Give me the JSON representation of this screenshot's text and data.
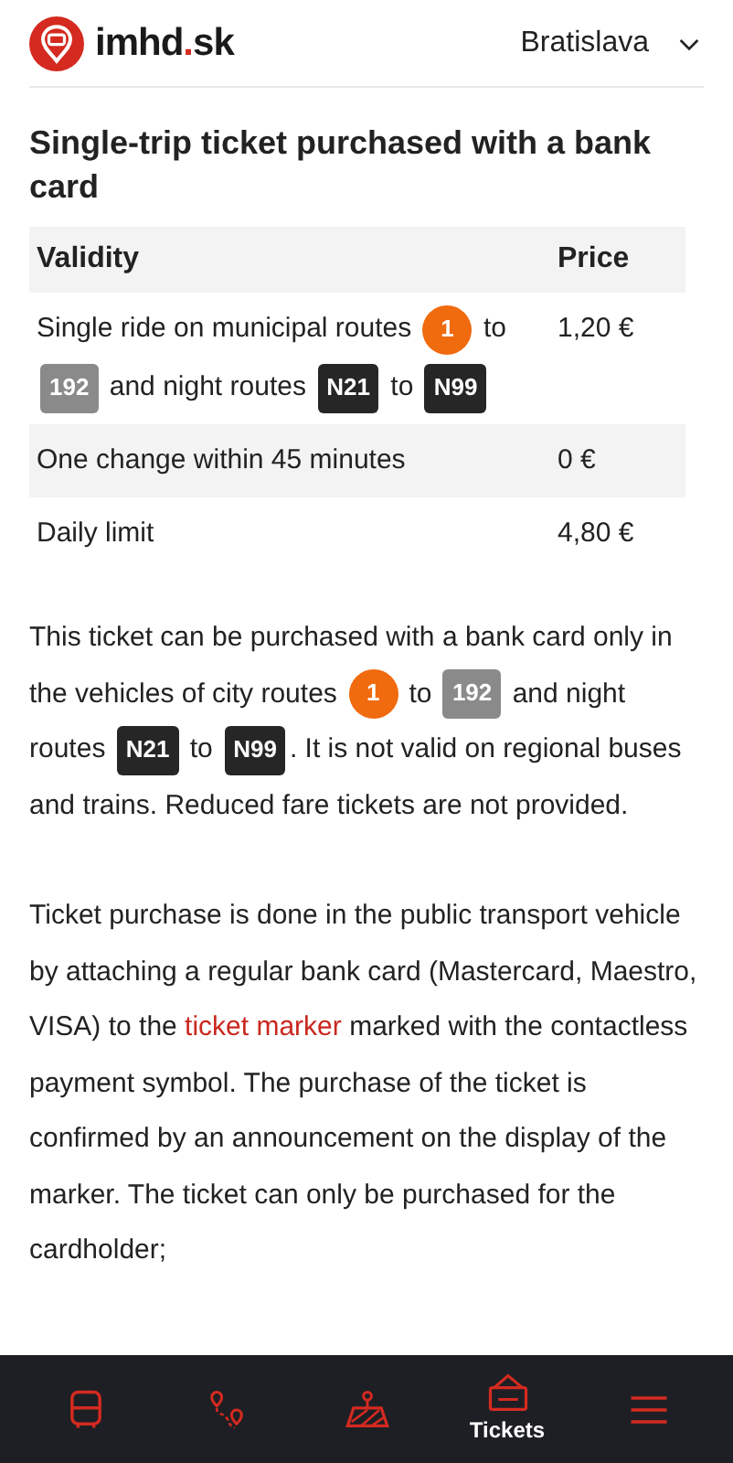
{
  "header": {
    "logo": {
      "name": "imhd",
      "dot": ".",
      "tld": "sk"
    },
    "city": "Bratislava"
  },
  "title": "Single-trip ticket purchased with a bank card",
  "table": {
    "columns": [
      "Validity",
      "Price"
    ],
    "rows": [
      {
        "validity": [
          {
            "kind": "text",
            "text": "Single ride on municipal routes "
          },
          {
            "kind": "tram",
            "text": "1"
          },
          {
            "kind": "text",
            "text": " to "
          },
          {
            "kind": "bus",
            "text": "192"
          },
          {
            "kind": "text",
            "text": " and night routes "
          },
          {
            "kind": "night",
            "text": "N21"
          },
          {
            "kind": "text",
            "text": " to "
          },
          {
            "kind": "night",
            "text": "N99"
          }
        ],
        "price": "1,20 €"
      },
      {
        "validity": [
          {
            "kind": "text",
            "text": "One change within 45 minutes"
          }
        ],
        "price": "0 €"
      },
      {
        "validity": [
          {
            "kind": "text",
            "text": "Daily limit"
          }
        ],
        "price": "4,80 €"
      }
    ]
  },
  "paragraphs": [
    [
      {
        "kind": "text",
        "text": "This ticket can be purchased with a bank card only in the vehicles of city routes "
      },
      {
        "kind": "tram",
        "text": "1"
      },
      {
        "kind": "text",
        "text": " to "
      },
      {
        "kind": "bus",
        "text": "192"
      },
      {
        "kind": "text",
        "text": " and night routes "
      },
      {
        "kind": "night",
        "text": "N21"
      },
      {
        "kind": "text",
        "text": " to "
      },
      {
        "kind": "night",
        "text": "N99"
      },
      {
        "kind": "text",
        "text": ". It is not valid on regional buses and trains. Reduced fare tickets are not provided."
      }
    ],
    [
      {
        "kind": "text",
        "text": "Ticket purchase is done in the public transport vehicle by attaching a regular bank card (Mastercard, Maestro, VISA) to the "
      },
      {
        "kind": "link",
        "text": "ticket marker"
      },
      {
        "kind": "text",
        "text": " marked with the contactless payment symbol. The purchase of the ticket is confirmed by an announcement on the display of the marker. The ticket can only be purchased for the cardholder;"
      }
    ]
  ],
  "nav": [
    {
      "selected": false
    },
    {
      "selected": false
    },
    {
      "selected": false
    },
    {
      "label": "Tickets",
      "selected": true
    },
    {
      "selected": false
    }
  ]
}
